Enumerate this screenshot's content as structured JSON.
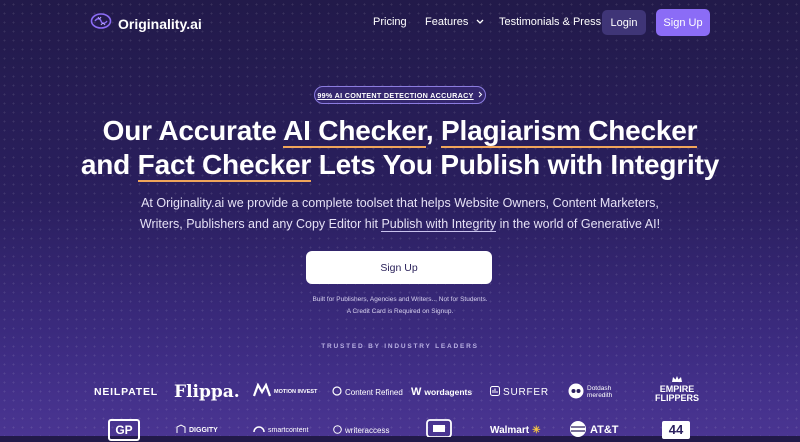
{
  "nav": {
    "logo_text": "Originality.ai",
    "links": [
      "Pricing",
      "Features",
      "Testimonials & Press"
    ],
    "login": "Login",
    "signup": "Sign Up"
  },
  "hero": {
    "badge": "99% AI CONTENT DETECTION ACCURACY",
    "line1_pre": "Our Accurate ",
    "hl1": "AI Checker",
    "sep": ", ",
    "hl2": "Plagiarism Checker",
    "line2_pre": "and ",
    "hl3": "Fact Checker",
    "line2_post": " Lets You Publish with Integrity",
    "sub_pre": "At Originality.ai we provide a complete toolset that helps Website Owners, Content Marketers, Writers, Publishers and any Copy Editor hit ",
    "sub_link": "Publish with Integrity",
    "sub_post": " in the world of Generative AI!",
    "cta": "Sign Up",
    "note1": "Built for Publishers, Agencies and Writers... Not for Students.",
    "note2": "A Credit Card is Required on Signup."
  },
  "trusted": {
    "title": "TRUSTED BY INDUSTRY LEADERS",
    "row1": [
      "NEILPATEL",
      "Flippa.",
      "MOTION INVEST",
      "Content Refined",
      "wordagents",
      "SURFER",
      "Dotdash meredith",
      "EMPIRE FLIPPERS"
    ],
    "row2": [
      "GP",
      "DIGGITY",
      "smartcontent",
      "writeraccess",
      "Walmart",
      "AT&T",
      "44"
    ]
  }
}
